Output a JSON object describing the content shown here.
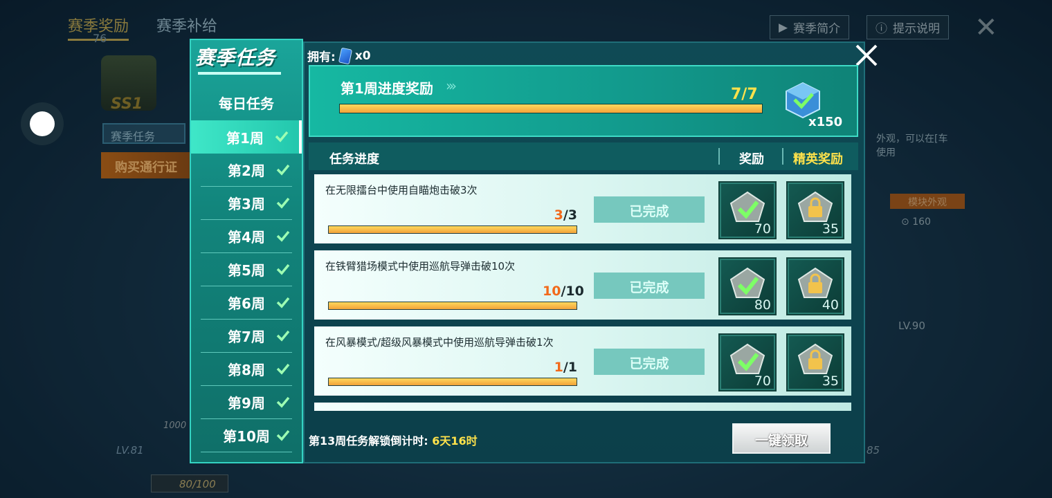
{
  "background": {
    "tabs": [
      "赛季奖励",
      "赛季补给"
    ],
    "level_small": "76",
    "emblem_text": "SS1",
    "left_label": "赛季任务",
    "left_button": "购买通行证",
    "top_right_buttons": [
      "赛季简介",
      "提示说明"
    ],
    "right_text": "外观，可以在[车使用",
    "module_label": "模块外观",
    "module_value": "160",
    "lv90": "LV.90",
    "lv81": "LV.81",
    "progress_text": "80/100",
    "item_count": "1000",
    "right_bottom_number": "85"
  },
  "dialog": {
    "title": "赛季任务",
    "owned_label": "拥有:",
    "owned_count": "x0",
    "daily_label": "每日任务",
    "weeks": [
      {
        "label": "第1周",
        "active": true
      },
      {
        "label": "第2周",
        "active": false
      },
      {
        "label": "第3周",
        "active": false
      },
      {
        "label": "第4周",
        "active": false
      },
      {
        "label": "第5周",
        "active": false
      },
      {
        "label": "第6周",
        "active": false
      },
      {
        "label": "第7周",
        "active": false
      },
      {
        "label": "第8周",
        "active": false
      },
      {
        "label": "第9周",
        "active": false
      },
      {
        "label": "第10周",
        "active": false
      }
    ],
    "weekly_reward": {
      "title": "第1周进度奖励",
      "progress": "7/7",
      "progress_fraction": 1.0,
      "reward_qty": "x150"
    },
    "table": {
      "col_progress": "任务进度",
      "col_reward": "奖励",
      "col_elite": "精英奖励"
    },
    "tasks": [
      {
        "desc": "在无限擂台中使用自瞄炮击破3次",
        "current": "3",
        "total": "/3",
        "fraction": 1.0,
        "status": "已完成",
        "reward": "70",
        "elite": "35"
      },
      {
        "desc": "在铁臂猎场模式中使用巡航导弹击破10次",
        "current": "10",
        "total": "/10",
        "fraction": 1.0,
        "status": "已完成",
        "reward": "80",
        "elite": "40"
      },
      {
        "desc": "在风暴模式/超级风暴模式中使用巡航导弹击破1次",
        "current": "1",
        "total": "/1",
        "fraction": 1.0,
        "status": "已完成",
        "reward": "70",
        "elite": "35"
      }
    ],
    "footer": {
      "timer_label": "第13周任务解锁倒计时:",
      "timer_value": "6天16时",
      "collect_all": "一键领取"
    }
  },
  "colors": {
    "accent_teal": "#1aa59a",
    "highlight_yellow": "#ffe24b",
    "progress_orange": "#f2a33a",
    "count_orange": "#f2691a"
  }
}
